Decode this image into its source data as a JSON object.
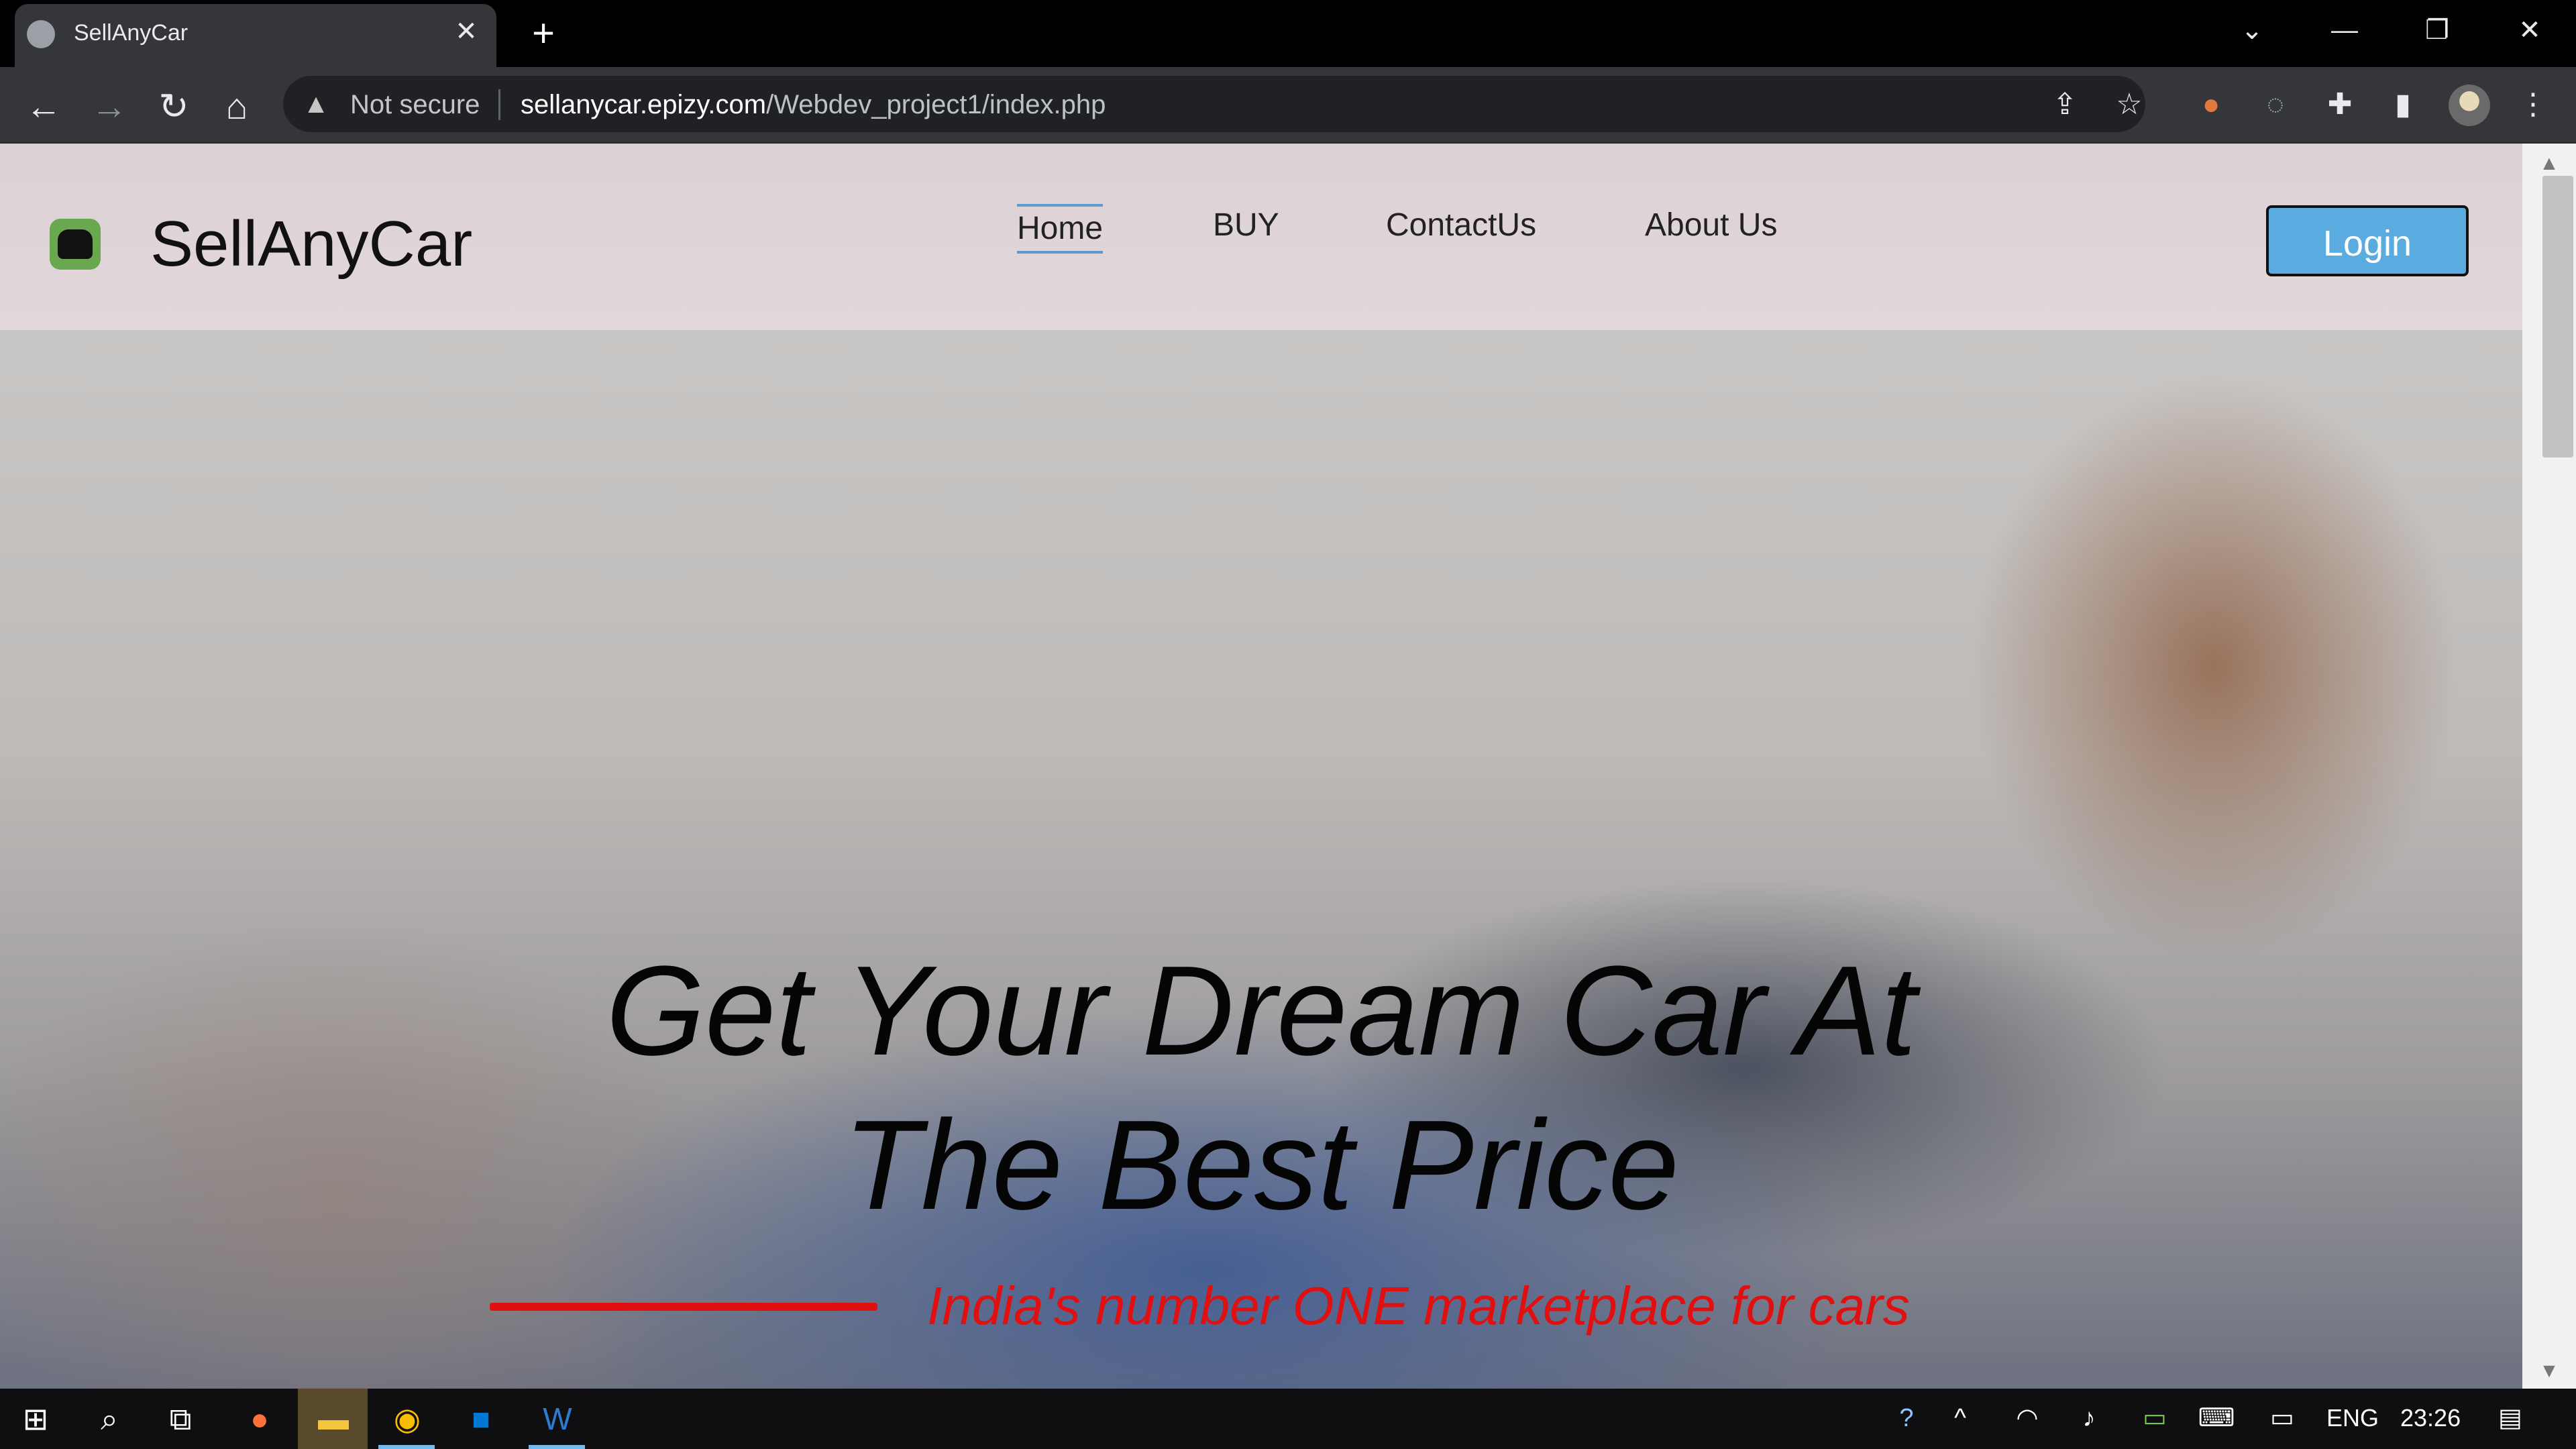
{
  "browser": {
    "tab_title": "SellAnyCar",
    "tab_close": "✕",
    "new_tab": "+",
    "security_label": "Not secure",
    "url_host": "sellanycar.epizy.com",
    "url_path": "/Webdev_project1/index.php"
  },
  "site": {
    "brand": "SellAnyCar",
    "nav": {
      "home": "Home",
      "buy": "BUY",
      "contact": "ContactUs",
      "about": "About Us"
    },
    "login_label": "Login"
  },
  "hero": {
    "headline_line1": "Get Your Dream Car At",
    "headline_line2": "The Best Price",
    "tagline": "India's number ONE marketplace for cars",
    "accent_color": "#e11010"
  },
  "taskbar": {
    "language": "ENG",
    "time": "23:26"
  }
}
